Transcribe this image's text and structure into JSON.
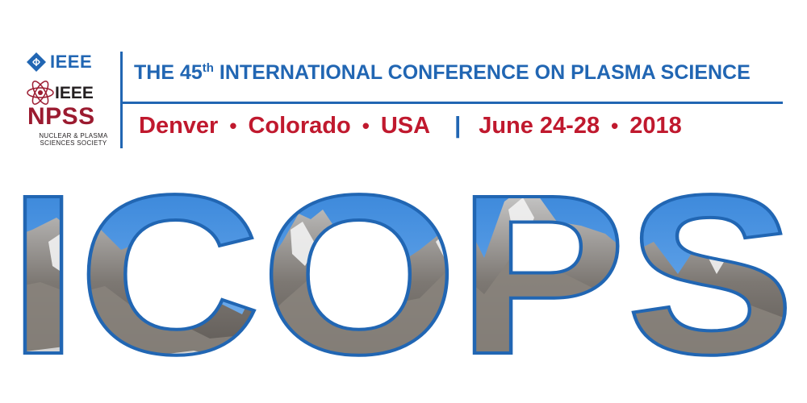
{
  "logos": {
    "ieee_top": "IEEE",
    "npss_ieee": "IEEE",
    "npss_name": "NPSS",
    "npss_sub_line1": "NUCLEAR & PLASMA",
    "npss_sub_line2": "SCIENCES SOCIETY"
  },
  "header": {
    "title_prefix": "THE 45",
    "title_sup": "th",
    "title_rest": " INTERNATIONAL CONFERENCE ON PLASMA SCIENCE"
  },
  "details": {
    "city": "Denver",
    "state": "Colorado",
    "country": "USA",
    "separator": "|",
    "dates": "June 24-28",
    "year": "2018",
    "dot": "•"
  },
  "banner": {
    "word": "ICOPS"
  },
  "colors": {
    "brand_blue": "#2166b3",
    "brand_red": "#c0192e",
    "npss_maroon": "#9b1b30"
  }
}
